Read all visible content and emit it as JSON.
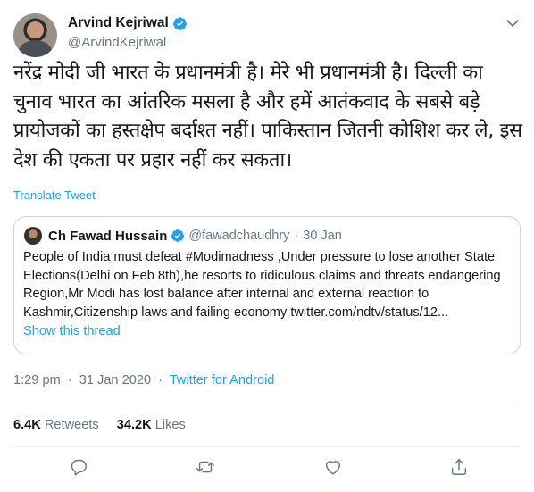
{
  "author": {
    "name": "Arvind Kejriwal",
    "handle": "@ArvindKejriwal",
    "verified": true
  },
  "tweet": {
    "text": "नरेंद्र मोदी जी भारत के प्रधानमंत्री है। मेरे भी प्रधानमंत्री है। दिल्ली का चुनाव भारत का आंतरिक मसला है और हमें आतंकवाद के सबसे बड़े प्रायोजकों का हस्तक्षेप बर्दाश्त नहीं। पाकिस्तान जितनी कोशिश कर ले, इस देश की एकता पर प्रहार नहीं कर सकता।",
    "translate_label": "Translate Tweet"
  },
  "quoted": {
    "name": "Ch Fawad Hussain",
    "handle": "@fawadchaudhry",
    "separator": "·",
    "date": "30 Jan",
    "text": "People of India must defeat #Modimadness ,Under pressure to lose another State Elections(Delhi on Feb 8th),he resorts to ridiculous claims and threats endangering Region,Mr Modi has lost balance after internal and external reaction to Kashmir,Citizenship laws and failing economy twitter.com/ndtv/status/12...",
    "show_thread": "Show this thread"
  },
  "meta": {
    "time": "1:29 pm",
    "separator": "·",
    "date": "31 Jan 2020",
    "source": "Twitter for Android"
  },
  "stats": {
    "retweets_count": "6.4K",
    "retweets_label": "Retweets",
    "likes_count": "34.2K",
    "likes_label": "Likes"
  },
  "icons": {
    "caret": "chevron-down-icon",
    "verified": "verified-badge-icon",
    "reply": "reply-icon",
    "retweet": "retweet-icon",
    "like": "heart-icon",
    "share": "share-icon"
  },
  "colors": {
    "accent": "#1da1f2",
    "muted": "#657786",
    "text": "#14171a",
    "border": "#ccd6dd"
  }
}
